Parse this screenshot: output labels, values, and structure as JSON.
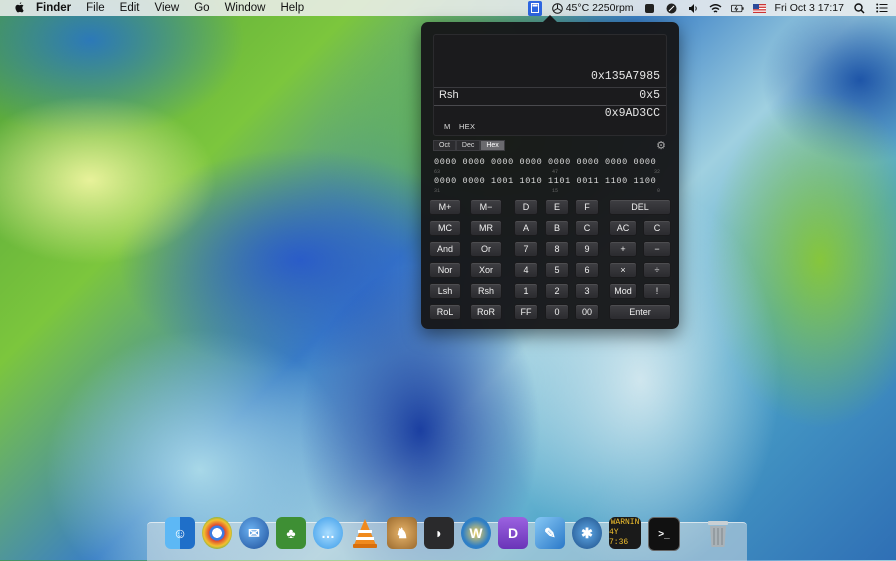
{
  "menubar": {
    "app_name": "Finder",
    "menus": [
      "File",
      "Edit",
      "View",
      "Go",
      "Window",
      "Help"
    ],
    "temp_fan": "45°C 2250rpm",
    "date_time": "Fri Oct 3  17:17"
  },
  "calculator": {
    "display": {
      "operand": "0x135A7985",
      "operation_label": "Rsh",
      "operation_value": "0x5",
      "result": "0x9AD3CC"
    },
    "memory_indicators": [
      "M",
      "HEX"
    ],
    "modes": [
      "Oct",
      "Dec",
      "Hex"
    ],
    "active_mode": "Hex",
    "bits": {
      "row1": "0000 0000 0000 0000 0000 0000 0000 0000",
      "row1_marks": [
        "63",
        "47",
        "32"
      ],
      "row2": "0000 0000 1001 1010 1101 0011 1100 1100",
      "row2_marks": [
        "31",
        "15",
        "0"
      ]
    },
    "keys": [
      [
        "M+",
        "M−",
        "D",
        "E",
        "F",
        "DEL"
      ],
      [
        "MC",
        "MR",
        "A",
        "B",
        "C",
        "AC",
        "C"
      ],
      [
        "And",
        "Or",
        "7",
        "8",
        "9",
        "+",
        "−"
      ],
      [
        "Nor",
        "Xor",
        "4",
        "5",
        "6",
        "×",
        "÷"
      ],
      [
        "Lsh",
        "Rsh",
        "1",
        "2",
        "3",
        "Mod",
        "!"
      ],
      [
        "RoL",
        "RoR",
        "FF",
        "0",
        "00",
        "Enter"
      ]
    ]
  },
  "dock": {
    "items": [
      {
        "name": "finder",
        "color": "#3a8ee6",
        "glyph": "☺"
      },
      {
        "name": "chrome",
        "color": "#e04b3a",
        "glyph": "◉"
      },
      {
        "name": "thunderbird",
        "color": "#2e63b0",
        "glyph": "✉"
      },
      {
        "name": "evernote",
        "color": "#4c9a3c",
        "glyph": "♣"
      },
      {
        "name": "messages",
        "color": "#5bb4f0",
        "glyph": "…"
      },
      {
        "name": "vlc",
        "color": "#f08a1e",
        "glyph": "▲"
      },
      {
        "name": "cyberduck",
        "color": "#c38a3a",
        "glyph": "♞"
      },
      {
        "name": "rss",
        "color": "#333333",
        "glyph": "◗"
      },
      {
        "name": "wordpress",
        "color": "#2f7fc6",
        "glyph": "W"
      },
      {
        "name": "dash",
        "color": "#8a4fd0",
        "glyph": "D"
      },
      {
        "name": "xcode",
        "color": "#3aa0e0",
        "glyph": "✎"
      },
      {
        "name": "sourcetree",
        "color": "#2a6aa8",
        "glyph": "✱"
      },
      {
        "name": "console",
        "color": "#222222",
        "glyph": "!"
      },
      {
        "name": "terminal",
        "color": "#111111",
        "glyph": ">_"
      },
      {
        "name": "trash",
        "color": "#9aa3a8",
        "glyph": "🗑"
      }
    ],
    "console_text": [
      "WARNIN",
      "4Y 7:36"
    ]
  }
}
